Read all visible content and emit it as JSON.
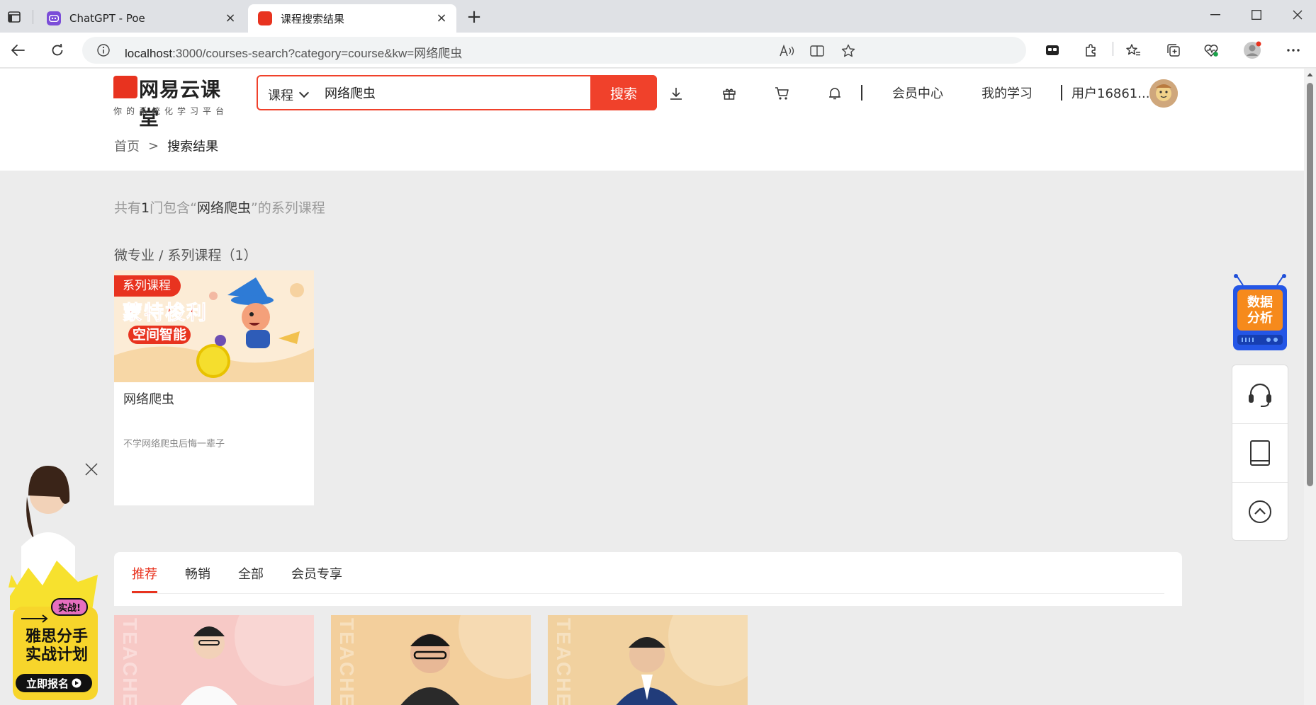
{
  "browser": {
    "tabs": [
      {
        "title": "ChatGPT - Poe",
        "active": false
      },
      {
        "title": "课程搜索结果",
        "active": true
      }
    ],
    "url_host": "localhost",
    "url_path": ":3000/courses-search?category=course&kw=网络爬虫"
  },
  "header": {
    "logo_text": "网易云课堂",
    "logo_subtitle": "你的系统化学习平台",
    "search_category": "课程",
    "search_value": "网络爬虫",
    "search_button": "搜索",
    "member_center": "会员中心",
    "my_learning": "我的学习",
    "user_name": "用户16861..."
  },
  "breadcrumb": {
    "home": "首页",
    "separator": ">",
    "current": "搜索结果"
  },
  "results": {
    "summary_prefix": "共有",
    "count": "1",
    "summary_middle": "门包含“",
    "keyword": "网络爬虫",
    "summary_suffix": "”的系列课程",
    "section_title": "微专业 / 系列课程（1）"
  },
  "course": {
    "badge": "系列课程",
    "cover_line1": "蒙特梭利",
    "cover_line2": "空间智能",
    "name": "网络爬虫",
    "description": "不学网络爬虫后悔一辈子"
  },
  "panel_tabs": [
    {
      "label": "推荐",
      "active": true
    },
    {
      "label": "畅销",
      "active": false
    },
    {
      "label": "全部",
      "active": false
    },
    {
      "label": "会员专享",
      "active": false
    }
  ],
  "teacher_cards": [
    {
      "watermark": "TEACHE",
      "bg": "#f7c9c6"
    },
    {
      "watermark": "TEACHE",
      "bg": "#f3cf9c"
    },
    {
      "watermark": "TEACHE",
      "bg": "#f1d19f"
    }
  ],
  "float_ad": {
    "tag": "实战!",
    "title_line1": "雅思分手",
    "title_line2": "实战计划",
    "cta": "立即报名"
  },
  "data_robot": {
    "line1": "数据",
    "line2": "分析"
  },
  "colors": {
    "accent": "#e8331f",
    "search_border": "#f0412b"
  }
}
